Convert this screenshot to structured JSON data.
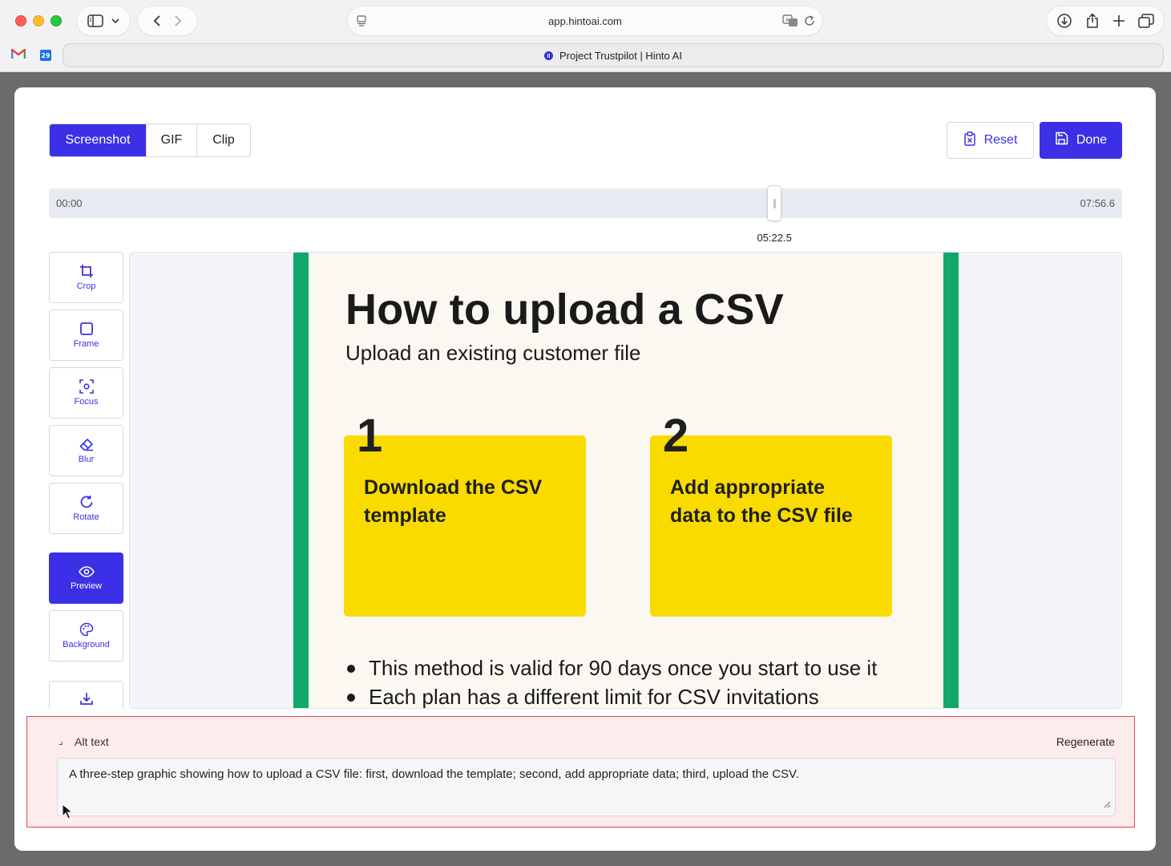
{
  "browser": {
    "url": "app.hintoai.com",
    "tab_title": "Project Trustpilot | Hinto AI",
    "calendar_badge": "29"
  },
  "mode_tabs": [
    {
      "label": "Screenshot",
      "active": true
    },
    {
      "label": "GIF",
      "active": false
    },
    {
      "label": "Clip",
      "active": false
    }
  ],
  "actions": {
    "reset_label": "Reset",
    "done_label": "Done"
  },
  "timeline": {
    "start": "00:00",
    "end": "07:56.6",
    "current": "05:22.5",
    "position_fraction": 0.676
  },
  "tools": [
    {
      "label": "Crop",
      "icon": "crop-icon"
    },
    {
      "label": "Frame",
      "icon": "frame-icon"
    },
    {
      "label": "Focus",
      "icon": "focus-icon"
    },
    {
      "label": "Blur",
      "icon": "eraser-icon"
    },
    {
      "label": "Rotate",
      "icon": "rotate-icon"
    },
    {
      "label": "Preview",
      "icon": "eye-icon",
      "active": true
    },
    {
      "label": "Background",
      "icon": "palette-icon"
    },
    {
      "label": "",
      "icon": "download-icon"
    }
  ],
  "slide": {
    "title": "How to upload a CSV",
    "subtitle": "Upload an existing customer file",
    "steps": [
      {
        "number": "1",
        "text": "Download the CSV template"
      },
      {
        "number": "2",
        "text": "Add appropriate data to the CSV file"
      }
    ],
    "bullets": [
      "This method is valid for 90 days once you start to use it",
      "Each plan has a different limit for CSV invitations"
    ],
    "colors": {
      "accent_bar": "#11a86a",
      "card": "#f9db00",
      "background": "#fbf8f1"
    }
  },
  "alt_text": {
    "label": "Alt text",
    "regenerate_label": "Regenerate",
    "value": "A three-step graphic showing how to upload a CSV file: first, download the template; second, add appropriate data; third, upload the CSV."
  },
  "colors": {
    "primary": "#3b30e6",
    "error_border": "#e4484b"
  }
}
